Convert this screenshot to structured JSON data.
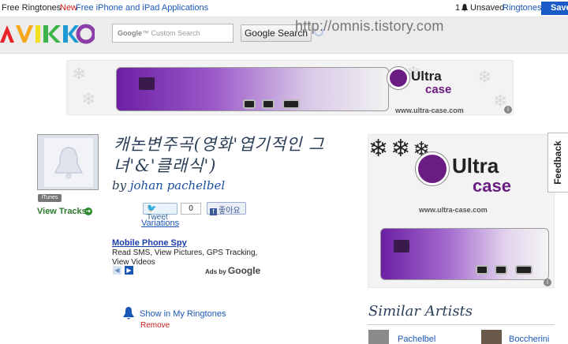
{
  "topbar": {
    "free_ringtones": "Free Ringtones",
    "new_label": "New",
    "new_link": "Free iPhone and iPad Applications",
    "unsaved_count": "1",
    "unsaved_label": "Unsaved",
    "ringtones_link": "Ringtones",
    "save_label": "Save"
  },
  "header": {
    "logo_alt": "AVIKKO",
    "search_placeholder": "Custom Search",
    "search_button": "Google Search",
    "watermark_url": "http://omnis.tistory.com"
  },
  "banner_ad": {
    "brand_main": "Ultra",
    "brand_sub": "case",
    "url": "www.ultra-case.com",
    "info": "i"
  },
  "song": {
    "title": "캐논변주곡(영화'엽기적인 그녀'&'클래식')",
    "by_label": "by",
    "artist": "johan pachelbel",
    "itunes_badge": "iTunes",
    "view_tracks": "View Tracks"
  },
  "social": {
    "tweet_label": "Tweet",
    "tweet_count": "0",
    "fb_label": "좋아요",
    "variations": "Variations"
  },
  "text_ad": {
    "title": "Mobile Phone Spy",
    "description": "Read SMS, View Pictures, GPS Tracking, View Videos",
    "ads_by": "Ads by",
    "google": "Google"
  },
  "ringtone_actions": {
    "show_in": "Show in My Ringtones",
    "remove": "Remove"
  },
  "side_ad": {
    "brand_main": "Ultra",
    "brand_sub": "case",
    "url": "www.ultra-case.com",
    "info": "i"
  },
  "feedback": "Feedback",
  "similar": {
    "heading": "Similar Artists",
    "artists": [
      "Pachelbel",
      "Boccherini"
    ]
  },
  "colors": {
    "link": "#1a56b8",
    "save_button": "#1a5bc8",
    "ultra_purple": "#6b1c82",
    "view_tracks_green": "#2a7a2a",
    "remove_red": "#cc1a1a"
  }
}
